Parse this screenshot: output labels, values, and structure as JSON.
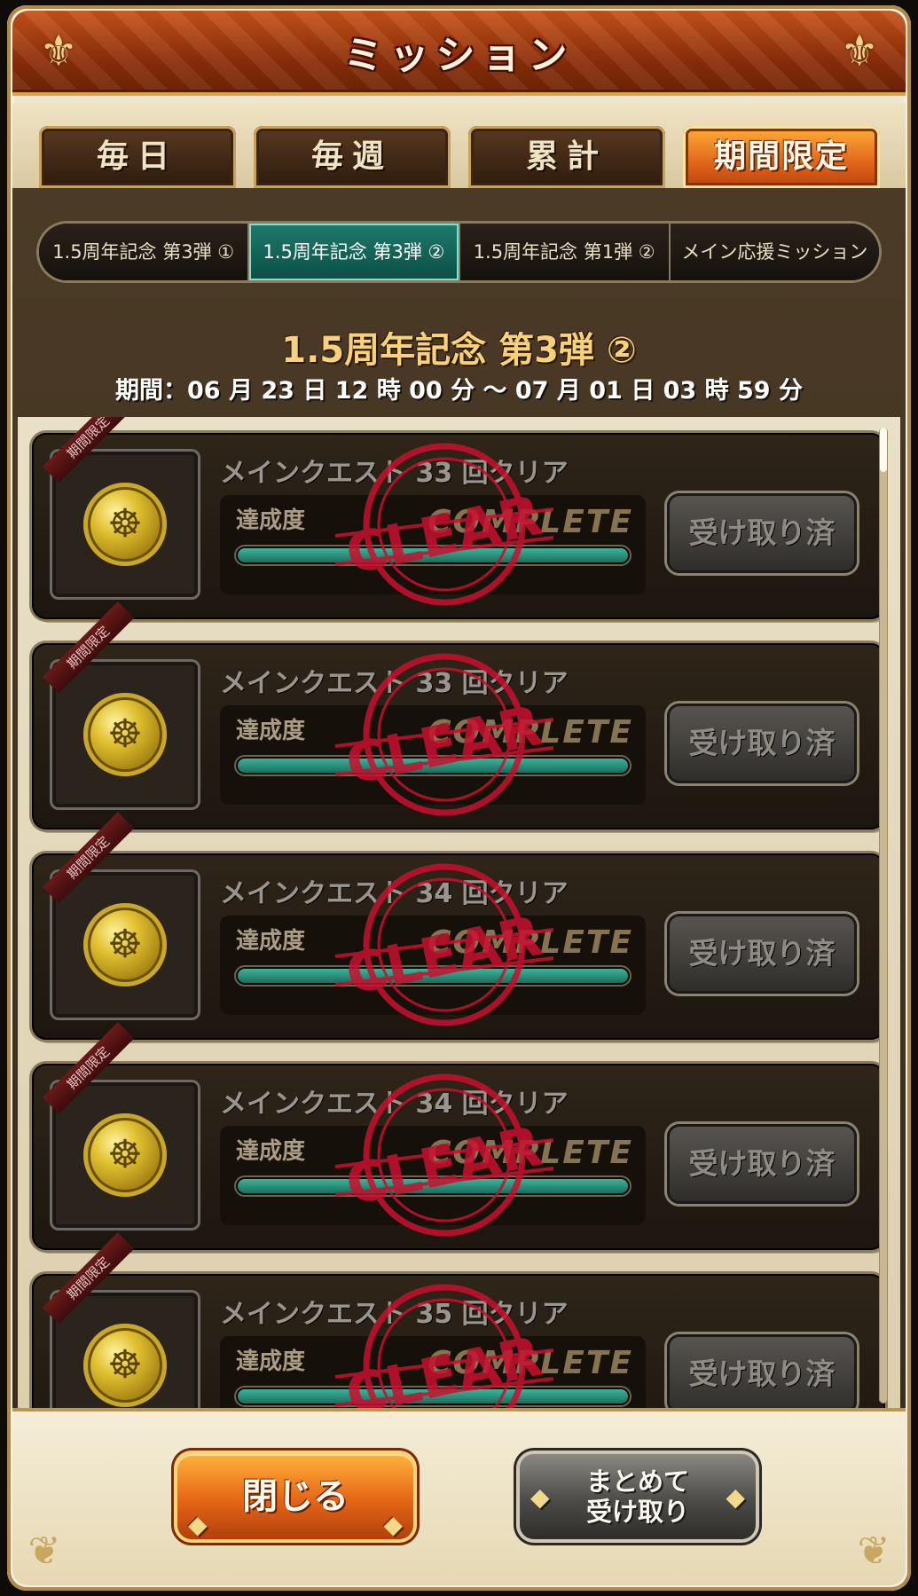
{
  "window": {
    "title": "ミッション"
  },
  "tabs": [
    {
      "label": "毎日",
      "active": false
    },
    {
      "label": "毎週",
      "active": false
    },
    {
      "label": "累計",
      "active": false
    },
    {
      "label": "期間限定",
      "active": true
    }
  ],
  "subtabs": [
    {
      "label": "1.5周年記念 第3弾 ①",
      "active": false
    },
    {
      "label": "1.5周年記念 第3弾 ②",
      "active": true
    },
    {
      "label": "1.5周年記念 第1弾 ②",
      "active": false
    },
    {
      "label": "メイン応援ミッション",
      "active": false
    }
  ],
  "event": {
    "title": "1.5周年記念 第3弾 ②",
    "period": "期間：06 月 23 日 12 時 00 分 ～ 07 月 01 日 03 時 59 分"
  },
  "missions": [
    {
      "ribbon": "期間限定",
      "name": "メインクエスト 33 回クリア",
      "progress_label": "達成度",
      "complete_text": "COMPLETE",
      "progress": 1.0,
      "button": "受け取り済",
      "stamp": "CLEAR"
    },
    {
      "ribbon": "期間限定",
      "name": "メインクエスト 33 回クリア",
      "progress_label": "達成度",
      "complete_text": "COMPLETE",
      "progress": 1.0,
      "button": "受け取り済",
      "stamp": "CLEAR"
    },
    {
      "ribbon": "期間限定",
      "name": "メインクエスト 34 回クリア",
      "progress_label": "達成度",
      "complete_text": "COMPLETE",
      "progress": 1.0,
      "button": "受け取り済",
      "stamp": "CLEAR"
    },
    {
      "ribbon": "期間限定",
      "name": "メインクエスト 34 回クリア",
      "progress_label": "達成度",
      "complete_text": "COMPLETE",
      "progress": 1.0,
      "button": "受け取り済",
      "stamp": "CLEAR"
    },
    {
      "ribbon": "期間限定",
      "name": "メインクエスト 35 回クリア",
      "progress_label": "達成度",
      "complete_text": "COMPLETE",
      "progress": 1.0,
      "button": "受け取り済",
      "stamp": "CLEAR"
    }
  ],
  "footer": {
    "close_label": "閉じる",
    "claim_all_line1": "まとめて",
    "claim_all_line2": "受け取り"
  },
  "colors": {
    "accent_orange": "#e56517",
    "active_subtab": "#1f7a6e",
    "progress_fill": "#3fb39a",
    "stamp_red": "#c8102e"
  },
  "icons": {
    "ornament": "fleur-de-lis-icon",
    "reward": "gold-coin-icon",
    "arrow": "arrow-icon"
  }
}
